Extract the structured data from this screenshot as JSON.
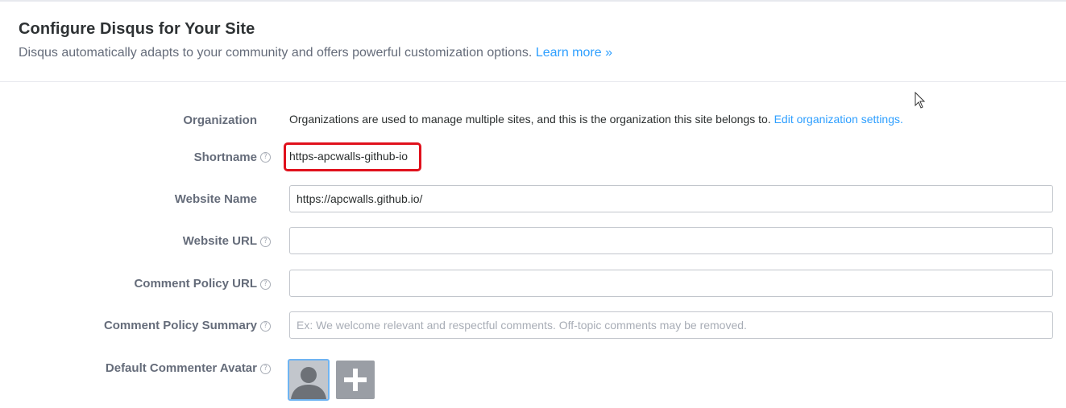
{
  "header": {
    "title": "Configure Disqus for Your Site",
    "subtitle": "Disqus automatically adapts to your community and offers powerful customization options.",
    "learn_more": "Learn more »"
  },
  "form": {
    "organization": {
      "label": "Organization",
      "text": "Organizations are used to manage multiple sites, and this is the organization this site belongs to.",
      "link": "Edit organization settings."
    },
    "shortname": {
      "label": "Shortname",
      "help_icon": "?",
      "value": "https-apcwalls-github-io"
    },
    "website_name": {
      "label": "Website Name",
      "value": "https://apcwalls.github.io/"
    },
    "website_url": {
      "label": "Website URL",
      "help_icon": "?",
      "value": ""
    },
    "comment_policy_url": {
      "label": "Comment Policy URL",
      "help_icon": "?",
      "value": ""
    },
    "comment_policy_summary": {
      "label": "Comment Policy Summary",
      "help_icon": "?",
      "value": "",
      "placeholder": "Ex: We welcome relevant and respectful comments. Off-topic comments may be removed."
    },
    "default_avatar": {
      "label": "Default Commenter Avatar",
      "help_icon": "?"
    }
  },
  "colors": {
    "link": "#2e9fff",
    "highlight_box": "#e0111c",
    "label": "#656c7a"
  }
}
